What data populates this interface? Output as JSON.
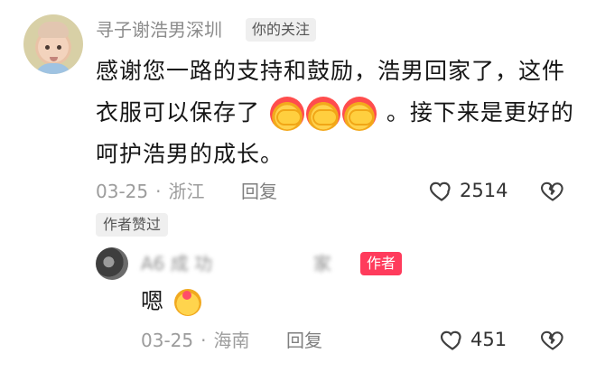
{
  "comment": {
    "username": "寻子谢浩男深圳",
    "follow_tag": "你的关注",
    "text_part1": "感谢您一路的支持和鼓励，浩男回家了，这件衣服可以保存了",
    "text_part2": "。接下来是更好的呵护浩男的成长。",
    "meta": {
      "date": "03-25",
      "location": "浙江",
      "reply_label": "回复"
    },
    "likes": "2514",
    "author_liked": "作者赞过"
  },
  "reply": {
    "username_blurred": "A6 成 功 　 　 　 　 家",
    "author_tag": "作者",
    "text": "嗯",
    "meta": {
      "date": "03-25",
      "location": "海南",
      "reply_label": "回复"
    },
    "likes": "451"
  },
  "icons": {
    "like": "heart-outline-icon",
    "dislike": "broken-heart-outline-icon",
    "emoji1": "handshake-heart-emoji",
    "emoji2": "finger-heart-emoji"
  },
  "colors": {
    "author_tag": "#ff3b5c",
    "meta_text": "#9c9c9c",
    "primary_text": "#161616"
  }
}
